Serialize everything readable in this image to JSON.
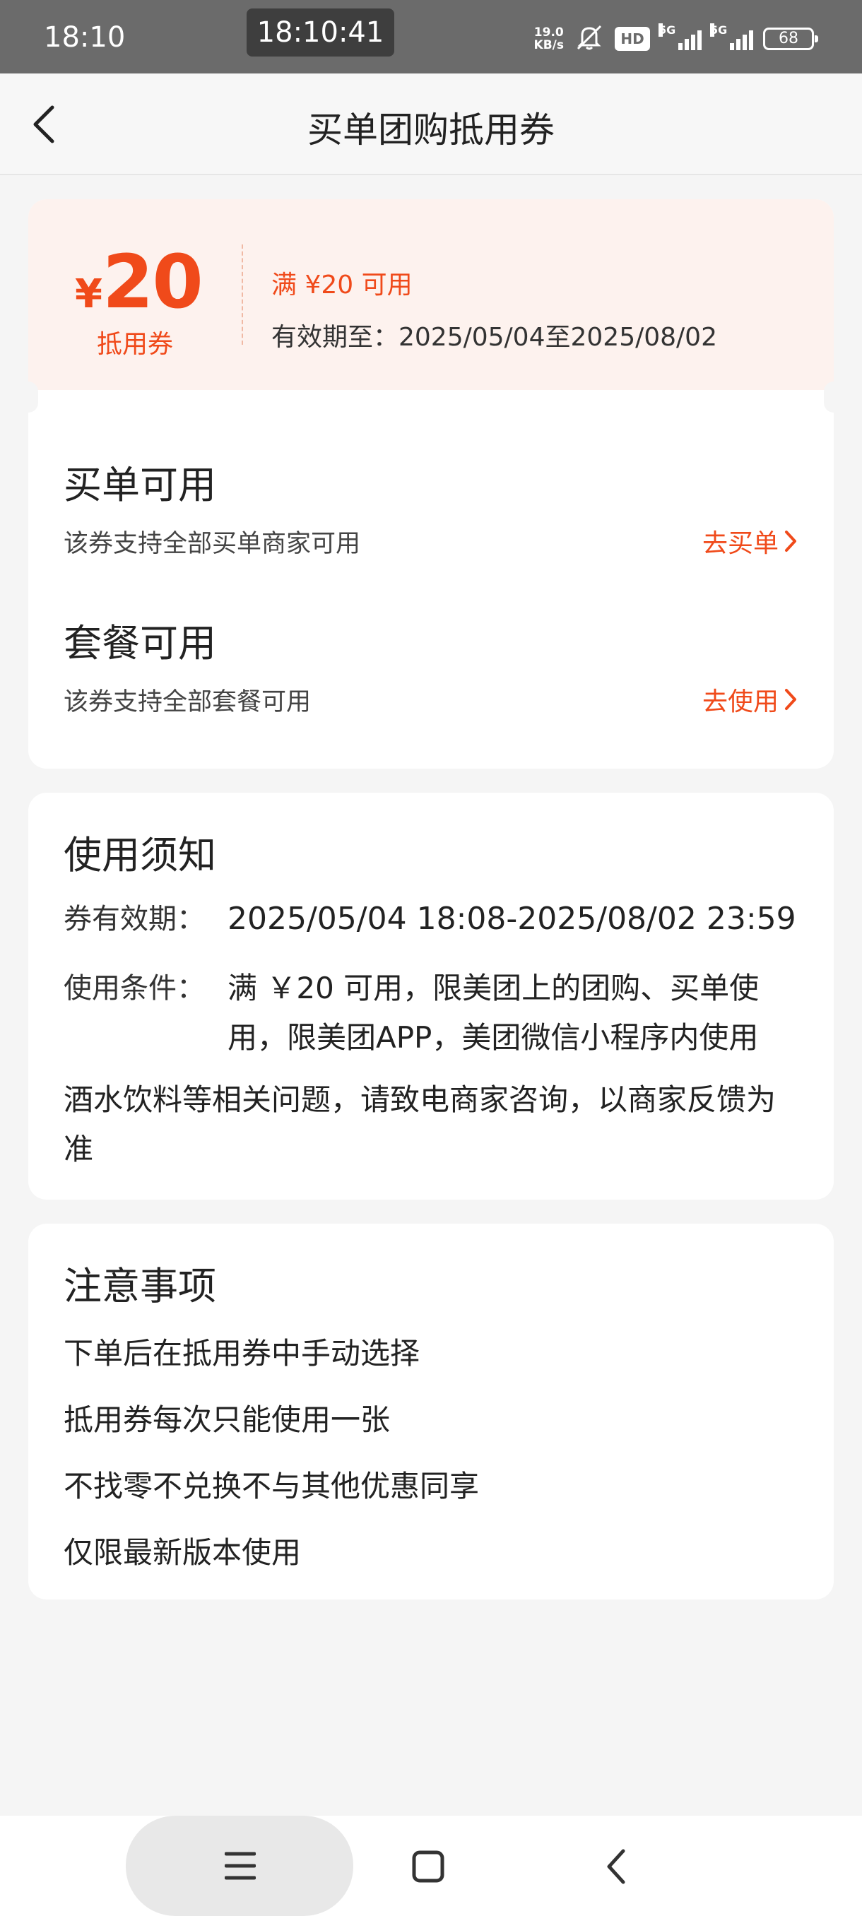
{
  "status_bar": {
    "time": "18:10",
    "clock_overlay": "18:10:41",
    "net_speed_value": "19.0",
    "net_speed_unit": "KB/s",
    "hd_label": "HD",
    "network_1": "5G",
    "network_2": "5G",
    "battery": "68"
  },
  "header": {
    "title": "买单团购抵用券"
  },
  "coupon": {
    "currency": "¥",
    "amount": "20",
    "amount_label": "抵用券",
    "threshold": "满 ¥20 可用",
    "validity": "有效期至：2025/05/04至2025/08/02",
    "accent_color": "#f04a1a"
  },
  "usage": [
    {
      "title": "买单可用",
      "desc": "该券支持全部买单商家可用",
      "link": "去买单"
    },
    {
      "title": "套餐可用",
      "desc": "该券支持全部套餐可用",
      "link": "去使用"
    }
  ],
  "notice": {
    "title": "使用须知",
    "validity_label": "券有效期：",
    "validity_value": "2025/05/04 18:08-2025/08/02 23:59",
    "condition_label": "使用条件：",
    "condition_value": "满 ￥20 可用，限美团上的团购、买单使用，限美团APP，美团微信小程序内使用",
    "extra": "酒水饮料等相关问题，请致电商家咨询，以商家反馈为准"
  },
  "notes": {
    "title": "注意事项",
    "items": [
      "下单后在抵用券中手动选择",
      "抵用券每次只能使用一张",
      "不找零不兑换不与其他优惠同享",
      "仅限最新版本使用"
    ]
  }
}
